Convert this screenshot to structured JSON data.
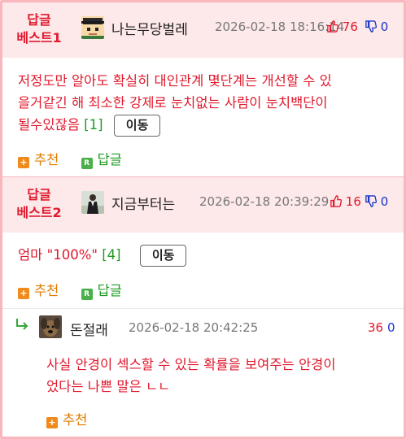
{
  "comments": [
    {
      "best_label": [
        "답글",
        "베스트1"
      ],
      "nickname": "나는무당벌레",
      "datetime": "2026-02-18 18:16:14",
      "upvotes": "76",
      "downvotes": "0",
      "text_lines": [
        "저정도만 알아도 확실히 대인관계 몇단계는 개선할 수 있",
        "을거같긴 해 최소한 강제로 눈치없는 사람이 눈치백단이",
        "될수있잖음"
      ],
      "reply_count": "[1]",
      "move_label": "이동",
      "recommend_label": "추천",
      "reply_label": "답글"
    },
    {
      "best_label": [
        "답글",
        "베스트2"
      ],
      "nickname": "지금부터는",
      "datetime": "2026-02-18 20:39:29",
      "upvotes": "16",
      "downvotes": "0",
      "text_lines": [
        "엄마 \"100%\""
      ],
      "reply_count": "[4]",
      "move_label": "이동",
      "recommend_label": "추천",
      "reply_label": "답글"
    }
  ],
  "reply": {
    "nickname": "돈절래",
    "datetime": "2026-02-18 20:42:25",
    "upvotes": "36",
    "downvotes": "0",
    "text_lines": [
      "사실 안경이 섹스할 수 있는 확률을 보여주는 안경이",
      "었다는 나쁜 말은 ㄴㄴ"
    ],
    "recommend_label": "추천"
  },
  "icons": {
    "thumb_up": "thumbs-up-icon",
    "thumb_down": "thumbs-down-icon",
    "recommend": "plus-icon",
    "reply": "reply-r-icon",
    "reply_arrow": "reply-arrow-icon"
  },
  "colors": {
    "accent_red": "#e0192d",
    "header_bg": "#fde8ea",
    "border_pink": "#f7b7bd",
    "vote_down_blue": "#1736c9",
    "count_green": "#1e9a22",
    "recommend_orange": "#e07c00"
  }
}
